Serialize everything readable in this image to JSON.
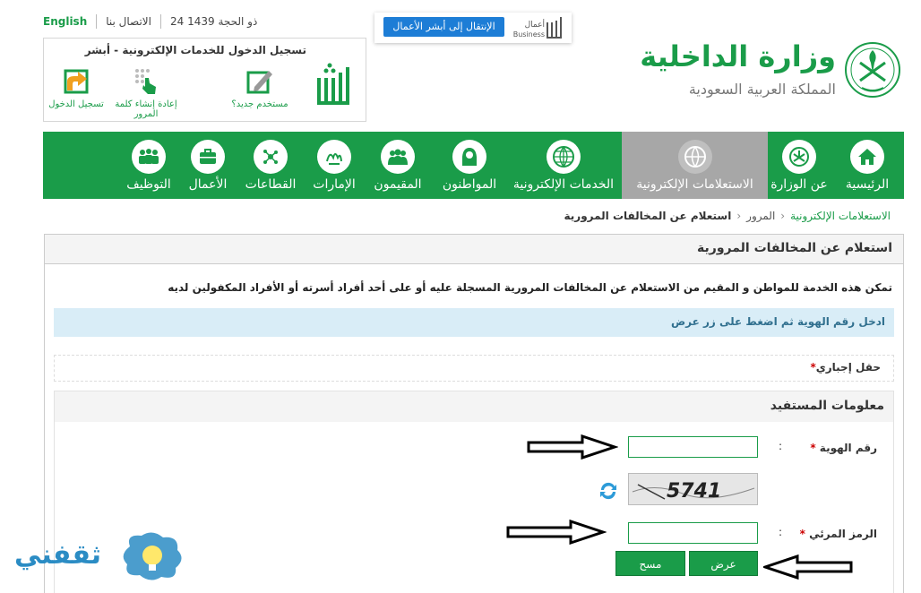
{
  "topbar": {
    "english": "English",
    "contact": "الاتصال بنا",
    "date": "24 ذو الحجة 1439"
  },
  "login": {
    "title": "تسجيل الدخول للخدمات الإلكترونية - أبشر",
    "items": [
      {
        "label": "مستخدم جديد؟",
        "icon": "new-user-icon"
      },
      {
        "label": "إعادة إنشاء كلمة المرور",
        "icon": "reset-password-icon"
      },
      {
        "label": "تسجيل الدخول",
        "icon": "login-icon"
      }
    ]
  },
  "business": {
    "button": "الإنتقال إلى أبشر الأعمال",
    "logo_ar": "أعمال",
    "logo_en": "Business"
  },
  "ministry": {
    "title": "وزارة الداخلية",
    "subtitle": "المملكة العربية السعودية"
  },
  "nav": {
    "items": [
      {
        "label": "الرئيسية",
        "icon": "home-icon",
        "active": false
      },
      {
        "label": "عن الوزارة",
        "icon": "emblem-icon",
        "active": false
      },
      {
        "label": "الاستعلامات الإلكترونية",
        "icon": "globe-pin-icon",
        "active": true
      },
      {
        "label": "الخدمات الإلكترونية",
        "icon": "globe-icon",
        "active": false
      },
      {
        "label": "المواطنون",
        "icon": "citizen-icon",
        "active": false
      },
      {
        "label": "المقيمون",
        "icon": "residents-icon",
        "active": false
      },
      {
        "label": "الإمارات",
        "icon": "emirates-icon",
        "active": false
      },
      {
        "label": "القطاعات",
        "icon": "sectors-icon",
        "active": false
      },
      {
        "label": "الأعمال",
        "icon": "briefcase-icon",
        "active": false
      },
      {
        "label": "التوظيف",
        "icon": "employment-icon",
        "active": false
      }
    ]
  },
  "breadcrumb": {
    "items": [
      "الاستعلامات الإلكترونية",
      "المرور",
      "استعلام عن المخالفات المرورية"
    ]
  },
  "page": {
    "title": "استعلام عن المخالفات المرورية",
    "description": "تمكن هذه الخدمة للمواطن و المقيم من الاستعلام عن المخالفات المرورية المسجلة عليه أو على أحد أفراد أسرته أو الأفراد المكفولين لديه",
    "info": "ادخل رقم الهوية ثم اضغط على زر عرض",
    "required_star": "*",
    "required_label": "حقل إجباري"
  },
  "form": {
    "section_title": "معلومات المستفيد",
    "id_label": "رقم الهوية",
    "id_value": "",
    "captcha_text": "5741",
    "visual_code_label": "الرمز المرئي",
    "visual_code_value": "",
    "colon": ":",
    "star": "*",
    "show_button": "عرض",
    "clear_button": "مسح"
  },
  "watermark": {
    "text": "ثقفني"
  },
  "colors": {
    "green": "#1a9c49",
    "active_gray": "#a7a7a7",
    "info_bg": "#d9edf7",
    "info_text": "#31708f"
  }
}
